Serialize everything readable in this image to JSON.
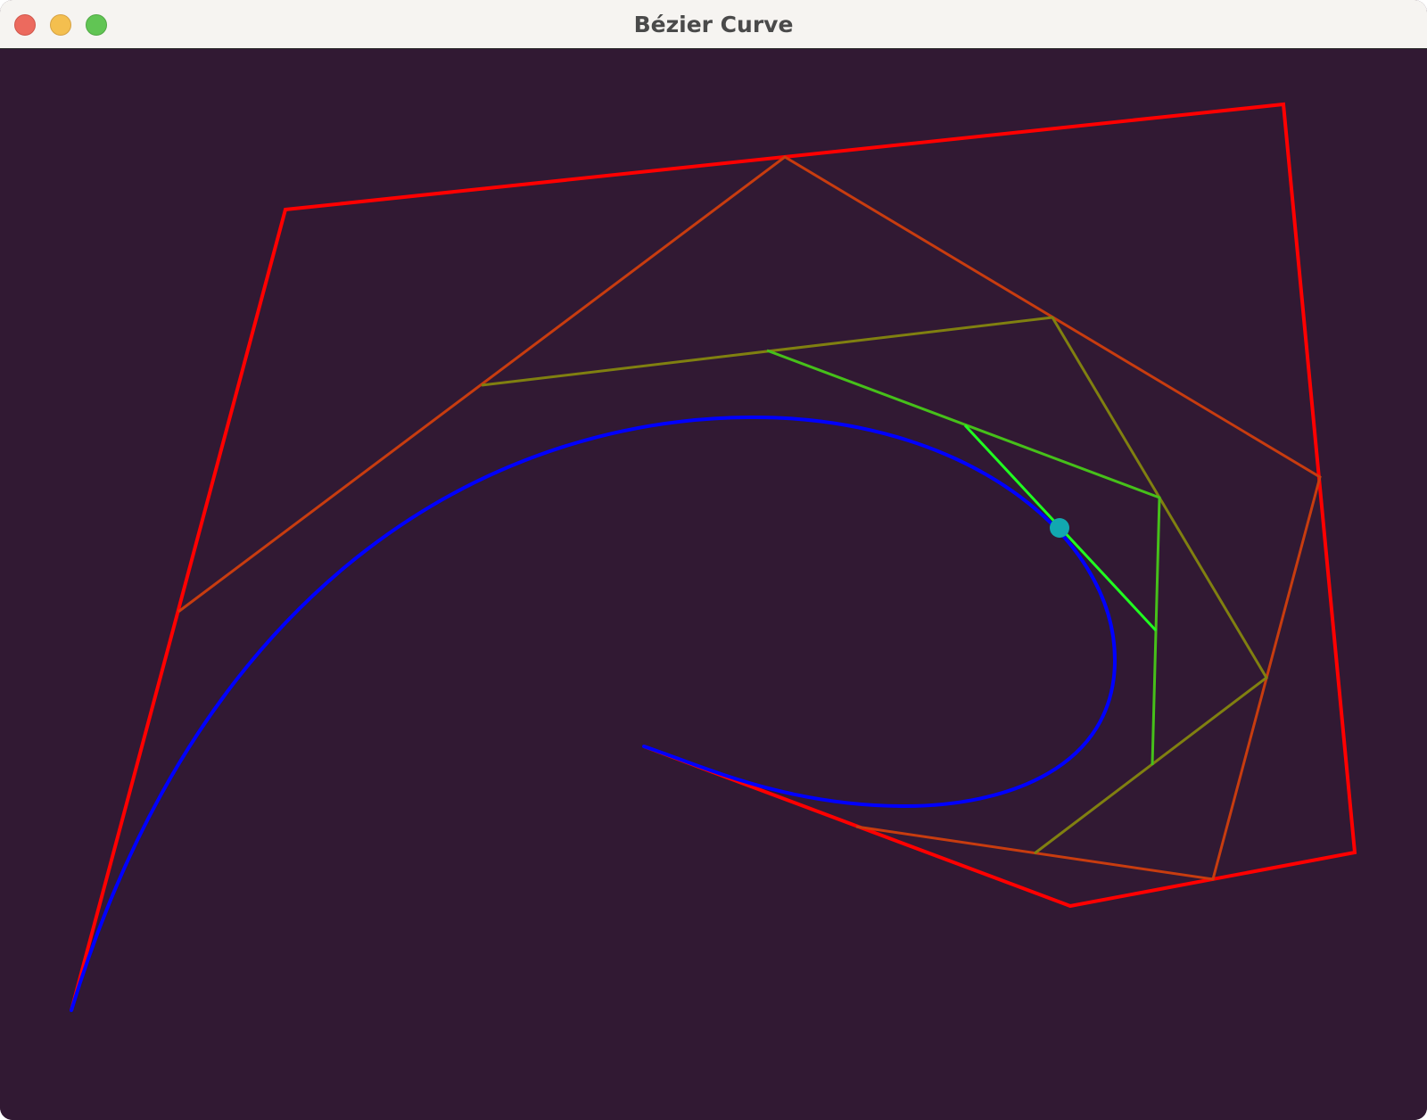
{
  "window": {
    "title": "Bézier Curve",
    "controls": {
      "close_icon": "close-icon",
      "minimize_icon": "minimize-icon",
      "zoom_icon": "zoom-icon"
    }
  },
  "colors": {
    "background": "#311933",
    "titlebar": "#f6f4f1",
    "control_polygon": "#ff0000",
    "level_1": "#c83c0f",
    "level_2": "#808010",
    "level_3": "#46c01a",
    "level_4": "#20ff20",
    "curve": "#0000ff",
    "point": "#12a8b0"
  }
}
